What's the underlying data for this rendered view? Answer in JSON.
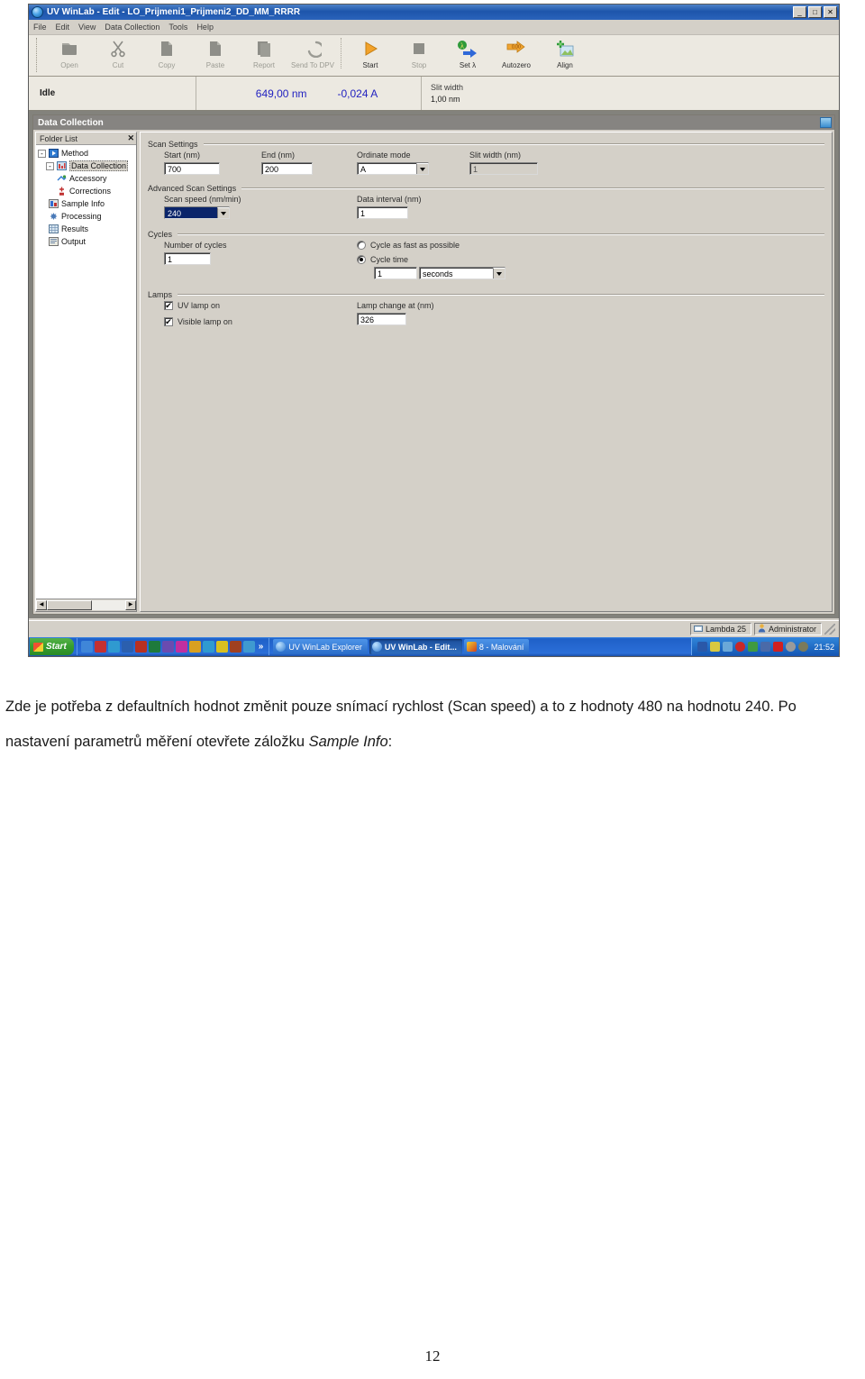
{
  "window": {
    "title": "UV WinLab - Edit - LO_Prijmeni1_Prijmeni2_DD_MM_RRRR",
    "icon": "app-globe-icon",
    "controls": {
      "minimize": "_",
      "maximize": "□",
      "close": "✕"
    }
  },
  "menubar": {
    "items": [
      {
        "label": "File"
      },
      {
        "label": "Edit"
      },
      {
        "label": "View"
      },
      {
        "label": "Data Collection"
      },
      {
        "label": "Tools"
      },
      {
        "label": "Help"
      }
    ]
  },
  "toolbar": {
    "items": [
      {
        "label": "Open",
        "icon": "open-folder-icon",
        "enabled": false
      },
      {
        "label": "Cut",
        "icon": "scissors-icon",
        "enabled": false
      },
      {
        "label": "Copy",
        "icon": "copy-icon",
        "enabled": false
      },
      {
        "label": "Paste",
        "icon": "paste-icon",
        "enabled": false
      },
      {
        "label": "Report",
        "icon": "report-icon",
        "enabled": false
      },
      {
        "label": "Send To DPV",
        "icon": "send-to-dpv-icon",
        "enabled": false
      },
      {
        "label": "Start",
        "icon": "play-triangle-icon",
        "enabled": true
      },
      {
        "label": "Stop",
        "icon": "stop-square-icon",
        "enabled": false
      },
      {
        "label": "Set λ",
        "icon": "set-lambda-icon",
        "enabled": true
      },
      {
        "label": "Autozero",
        "icon": "autozero-icon",
        "enabled": true
      },
      {
        "label": "Align",
        "icon": "align-icon",
        "enabled": true
      }
    ]
  },
  "status_strip": {
    "state": "Idle",
    "wavelength": "649,00 nm",
    "absorbance": "-0,024 A",
    "slit_width_label": "Slit width",
    "slit_width_value": "1,00 nm"
  },
  "mdi": {
    "title": "Data Collection",
    "restore_icon": "restore-window-icon"
  },
  "folder_list": {
    "header": "Folder List",
    "close_label": "✕",
    "nodes": [
      {
        "label": "Method",
        "depth": 0,
        "expander": "-",
        "icon": "method-icon",
        "selected": false
      },
      {
        "label": "Data Collection",
        "depth": 1,
        "expander": "-",
        "icon": "data-collection-icon",
        "selected": true
      },
      {
        "label": "Accessory",
        "depth": 2,
        "expander": "",
        "icon": "accessory-icon",
        "selected": false
      },
      {
        "label": "Corrections",
        "depth": 2,
        "expander": "",
        "icon": "corrections-icon",
        "selected": false
      },
      {
        "label": "Sample Info",
        "depth": 1,
        "expander": "",
        "icon": "sample-info-icon",
        "selected": false
      },
      {
        "label": "Processing",
        "depth": 1,
        "expander": "",
        "icon": "processing-icon",
        "selected": false
      },
      {
        "label": "Results",
        "depth": 1,
        "expander": "",
        "icon": "results-icon",
        "selected": false
      },
      {
        "label": "Output",
        "depth": 1,
        "expander": "",
        "icon": "output-icon",
        "selected": false
      }
    ]
  },
  "scan_settings": {
    "group_title": "Scan Settings",
    "start_label": "Start (nm)",
    "start_value": "700",
    "end_label": "End (nm)",
    "end_value": "200",
    "ordinate_label": "Ordinate mode",
    "ordinate_value": "A",
    "slit_label": "Slit width (nm)",
    "slit_value": "1"
  },
  "advanced_scan_settings": {
    "group_title": "Advanced Scan Settings",
    "scan_speed_label": "Scan speed (nm/min)",
    "scan_speed_value": "240",
    "data_interval_label": "Data interval (nm)",
    "data_interval_value": "1"
  },
  "cycles": {
    "group_title": "Cycles",
    "number_label": "Number of cycles",
    "number_value": "1",
    "fast_radio_label": "Cycle as fast as possible",
    "cycle_time_radio_label": "Cycle time",
    "cycle_time_value": "1",
    "cycle_time_units": "seconds"
  },
  "lamps": {
    "group_title": "Lamps",
    "uv_lamp_label": "UV lamp on",
    "uv_lamp_checked": "✔",
    "visible_lamp_label": "Visible lamp on",
    "visible_lamp_checked": "✔",
    "lamp_change_label": "Lamp change at (nm)",
    "lamp_change_value": "326"
  },
  "app_status_bar": {
    "instrument": "Lambda 25",
    "instrument_icon": "instrument-icon",
    "user": "Administrator",
    "user_icon": "user-icon"
  },
  "taskbar": {
    "start_label": "Start",
    "quick_launch_overflow": "»",
    "quick_launch": [
      {
        "icon": "ql-icon-1",
        "color": "#3f86d8"
      },
      {
        "icon": "ql-icon-2",
        "color": "#c43030"
      },
      {
        "icon": "ql-icon-3",
        "color": "#2f9ad0"
      },
      {
        "icon": "ql-icon-word",
        "color": "#2b5fae"
      },
      {
        "icon": "ql-icon-access",
        "color": "#b83020"
      },
      {
        "icon": "ql-icon-excel",
        "color": "#1e7a3c"
      },
      {
        "icon": "ql-icon-6",
        "color": "#6a4bb0"
      },
      {
        "icon": "ql-icon-7",
        "color": "#c02fa0"
      },
      {
        "icon": "ql-icon-8",
        "color": "#d8a020"
      },
      {
        "icon": "ql-icon-9",
        "color": "#2f9ad0"
      },
      {
        "icon": "ql-icon-save",
        "color": "#d8c020"
      },
      {
        "icon": "ql-icon-11",
        "color": "#a04020"
      },
      {
        "icon": "ql-icon-12",
        "color": "#3f9ad0"
      }
    ],
    "tasks": [
      {
        "label": "UV WinLab Explorer",
        "icon": "app-globe-icon",
        "active": false
      },
      {
        "label": "UV WinLab - Edit...",
        "icon": "app-globe-icon",
        "active": true
      },
      {
        "label": "8 - Malování",
        "icon": "paint-icon",
        "active": false
      }
    ],
    "tray": [
      {
        "icon": "network-icon",
        "color": "#2a58a8"
      },
      {
        "icon": "shield-icon",
        "color": "#d8c840"
      },
      {
        "icon": "lock-icon",
        "color": "#6aa8d8"
      },
      {
        "icon": "antivirus-icon",
        "color": "#c82828"
      },
      {
        "icon": "update-icon",
        "color": "#3f9a40"
      },
      {
        "icon": "drive-icon",
        "color": "#4a6aa8"
      },
      {
        "icon": "alert-icon",
        "color": "#d02020"
      },
      {
        "icon": "sound-icon",
        "color": "#9a9a9a"
      },
      {
        "icon": "clock-tray-icon",
        "color": "#7a7a5a"
      }
    ],
    "clock": "21:52"
  },
  "document": {
    "paragraph_part1": "Zde je potřeba z defaultních hodnot změnit pouze snímací rychlost (Scan speed) a to z hodnoty 480 na hodnotu 240. Po nastavení parametrů měření otevřete záložku ",
    "paragraph_emphasis": "Sample Info",
    "paragraph_part2": ":",
    "page_number": "12"
  }
}
